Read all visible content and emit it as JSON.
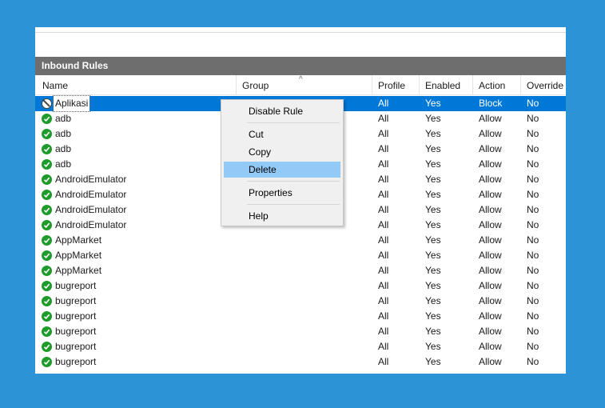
{
  "panel": {
    "title": "Inbound Rules"
  },
  "columns": [
    "Name",
    "Group",
    "Profile",
    "Enabled",
    "Action",
    "Override"
  ],
  "sort_indicator": "^",
  "rows": [
    {
      "name": "Aplikasi",
      "profile": "All",
      "enabled": "Yes",
      "action": "Block",
      "override": "No",
      "icon": "block-icon"
    },
    {
      "name": "adb",
      "profile": "All",
      "enabled": "Yes",
      "action": "Allow",
      "override": "No",
      "icon": "allow-check-icon"
    },
    {
      "name": "adb",
      "profile": "All",
      "enabled": "Yes",
      "action": "Allow",
      "override": "No",
      "icon": "allow-check-icon"
    },
    {
      "name": "adb",
      "profile": "All",
      "enabled": "Yes",
      "action": "Allow",
      "override": "No",
      "icon": "allow-check-icon"
    },
    {
      "name": "adb",
      "profile": "All",
      "enabled": "Yes",
      "action": "Allow",
      "override": "No",
      "icon": "allow-check-icon"
    },
    {
      "name": "AndroidEmulator",
      "profile": "All",
      "enabled": "Yes",
      "action": "Allow",
      "override": "No",
      "icon": "allow-check-icon"
    },
    {
      "name": "AndroidEmulator",
      "profile": "All",
      "enabled": "Yes",
      "action": "Allow",
      "override": "No",
      "icon": "allow-check-icon"
    },
    {
      "name": "AndroidEmulator",
      "profile": "All",
      "enabled": "Yes",
      "action": "Allow",
      "override": "No",
      "icon": "allow-check-icon"
    },
    {
      "name": "AndroidEmulator",
      "profile": "All",
      "enabled": "Yes",
      "action": "Allow",
      "override": "No",
      "icon": "allow-check-icon"
    },
    {
      "name": "AppMarket",
      "profile": "All",
      "enabled": "Yes",
      "action": "Allow",
      "override": "No",
      "icon": "allow-check-icon"
    },
    {
      "name": "AppMarket",
      "profile": "All",
      "enabled": "Yes",
      "action": "Allow",
      "override": "No",
      "icon": "allow-check-icon"
    },
    {
      "name": "AppMarket",
      "profile": "All",
      "enabled": "Yes",
      "action": "Allow",
      "override": "No",
      "icon": "allow-check-icon"
    },
    {
      "name": "bugreport",
      "profile": "All",
      "enabled": "Yes",
      "action": "Allow",
      "override": "No",
      "icon": "allow-check-icon"
    },
    {
      "name": "bugreport",
      "profile": "All",
      "enabled": "Yes",
      "action": "Allow",
      "override": "No",
      "icon": "allow-check-icon"
    },
    {
      "name": "bugreport",
      "profile": "All",
      "enabled": "Yes",
      "action": "Allow",
      "override": "No",
      "icon": "allow-check-icon"
    },
    {
      "name": "bugreport",
      "profile": "All",
      "enabled": "Yes",
      "action": "Allow",
      "override": "No",
      "icon": "allow-check-icon"
    },
    {
      "name": "bugreport",
      "profile": "All",
      "enabled": "Yes",
      "action": "Allow",
      "override": "No",
      "icon": "allow-check-icon"
    },
    {
      "name": "bugreport",
      "profile": "All",
      "enabled": "Yes",
      "action": "Allow",
      "override": "No",
      "icon": "allow-check-icon"
    }
  ],
  "context_menu": {
    "items": [
      "Disable Rule",
      "Cut",
      "Copy",
      "Delete",
      "Properties",
      "Help"
    ],
    "highlighted": "Delete"
  },
  "colors": {
    "background": "#2b93d6",
    "selection": "#0078d7",
    "menu_highlight": "#91c9f7",
    "header_bar": "#6e6e6e"
  }
}
